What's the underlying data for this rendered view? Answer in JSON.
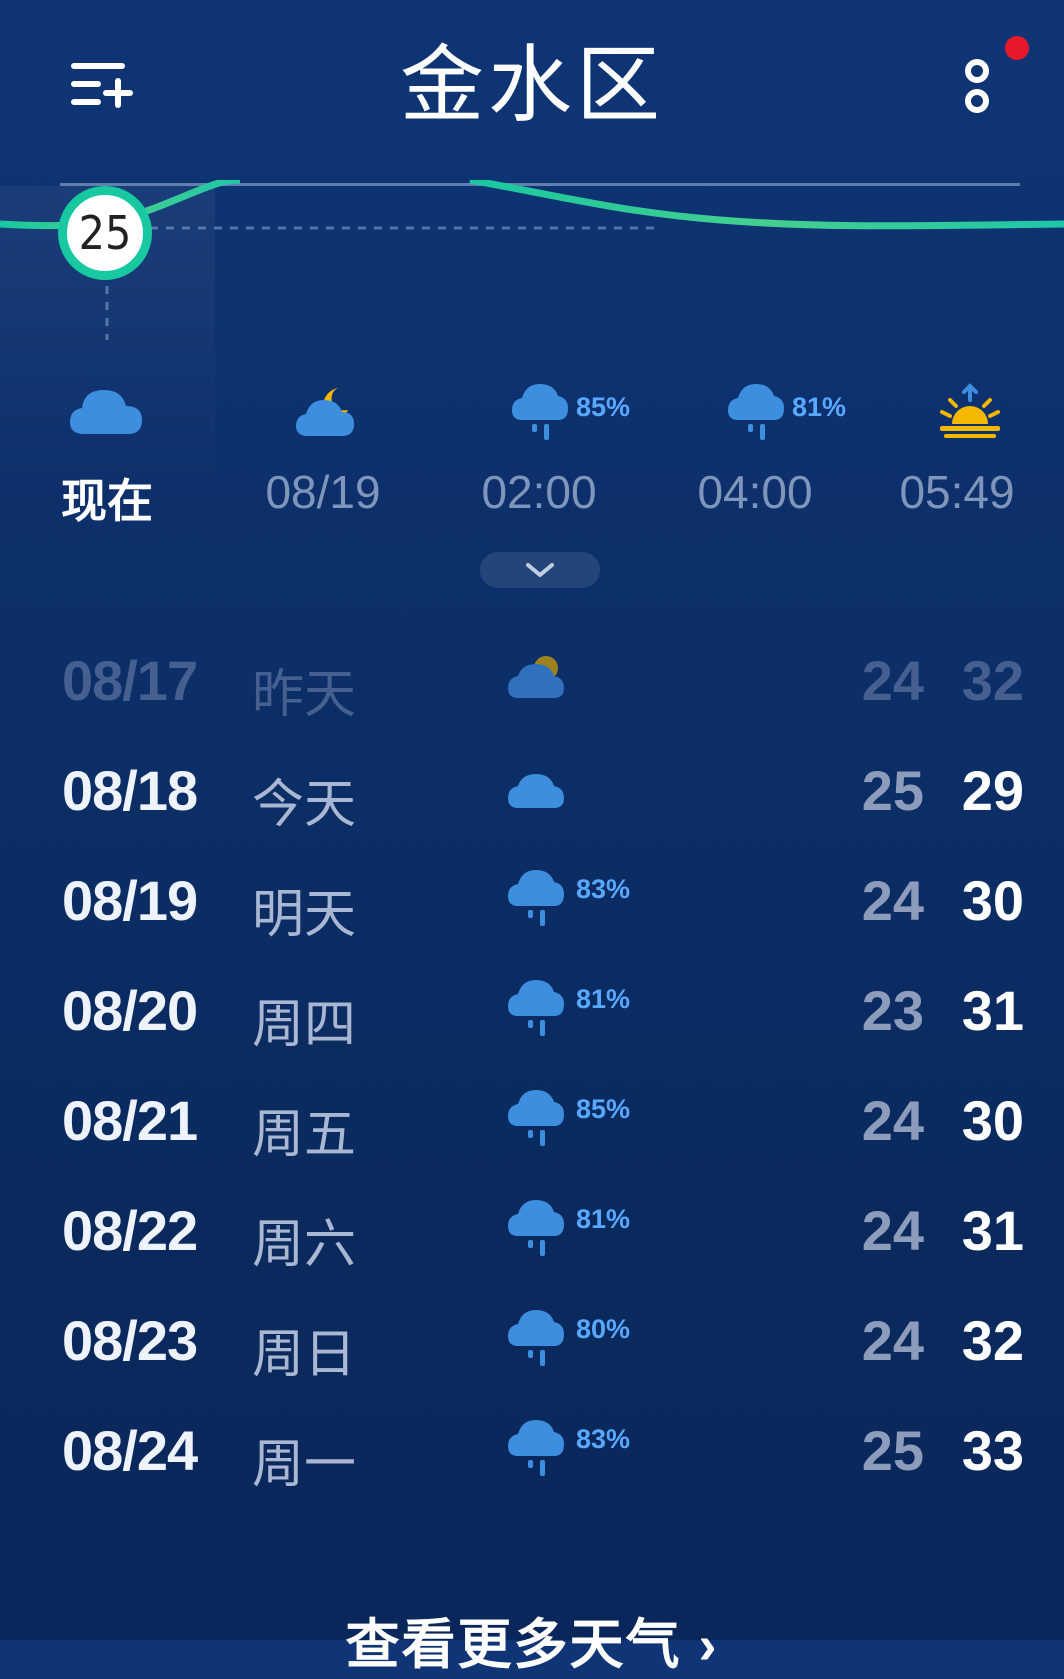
{
  "header": {
    "title": "金水区",
    "menu_icon": "add-city-icon",
    "more_icon": "more-icon"
  },
  "current_temperature": "25",
  "hourly": [
    {
      "label": "现在",
      "icon": "cloud-icon",
      "pct": ""
    },
    {
      "label": "08/19",
      "icon": "moon-cloud-icon",
      "pct": ""
    },
    {
      "label": "02:00",
      "icon": "rain-cloud-icon",
      "pct": "85%"
    },
    {
      "label": "04:00",
      "icon": "rain-cloud-icon",
      "pct": "81%"
    },
    {
      "label": "05:49",
      "icon": "sunrise-icon",
      "pct": ""
    }
  ],
  "daily": [
    {
      "date": "08/17",
      "name": "昨天",
      "icon": "partly-cloudy-icon",
      "pct": "",
      "low": "24",
      "high": "32",
      "past": true
    },
    {
      "date": "08/18",
      "name": "今天",
      "icon": "cloud-icon",
      "pct": "",
      "low": "25",
      "high": "29"
    },
    {
      "date": "08/19",
      "name": "明天",
      "icon": "rain-cloud-icon",
      "pct": "83%",
      "low": "24",
      "high": "30"
    },
    {
      "date": "08/20",
      "name": "周四",
      "icon": "rain-cloud-icon",
      "pct": "81%",
      "low": "23",
      "high": "31"
    },
    {
      "date": "08/21",
      "name": "周五",
      "icon": "rain-cloud-icon",
      "pct": "85%",
      "low": "24",
      "high": "30"
    },
    {
      "date": "08/22",
      "name": "周六",
      "icon": "rain-cloud-icon",
      "pct": "81%",
      "low": "24",
      "high": "31"
    },
    {
      "date": "08/23",
      "name": "周日",
      "icon": "rain-cloud-icon",
      "pct": "80%",
      "low": "24",
      "high": "32"
    },
    {
      "date": "08/24",
      "name": "周一",
      "icon": "rain-cloud-icon",
      "pct": "83%",
      "low": "25",
      "high": "33"
    }
  ],
  "more_weather_label": "查看更多天气 ›",
  "colors": {
    "accent": "#18c8a0",
    "rain": "#58a8ff",
    "sun": "#f5b800",
    "cloud": "#3e8ee0",
    "notification": "#e8192c"
  }
}
